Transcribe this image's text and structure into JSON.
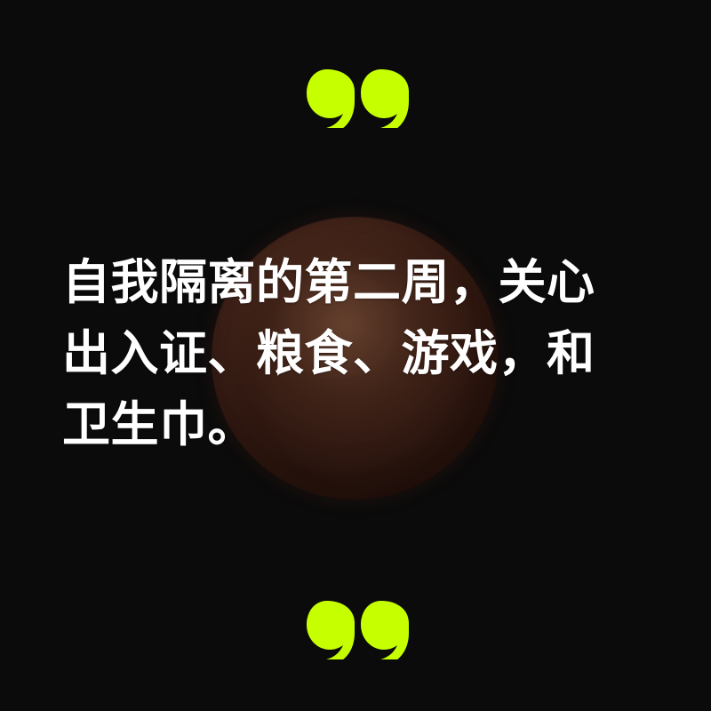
{
  "quote": {
    "lines": [
      "自我隔离的第二周，关心",
      "出入证、粮食、游戏，和",
      "卫生巾。"
    ]
  },
  "colors": {
    "background": "#0b0b0b",
    "quote_mark": "#c6ff00",
    "text": "#ffffff",
    "moon": "#7a3a22"
  },
  "icons": {
    "opening_quote": "left-double-quotation-icon",
    "closing_quote": "right-double-quotation-icon",
    "background_image": "moon"
  }
}
